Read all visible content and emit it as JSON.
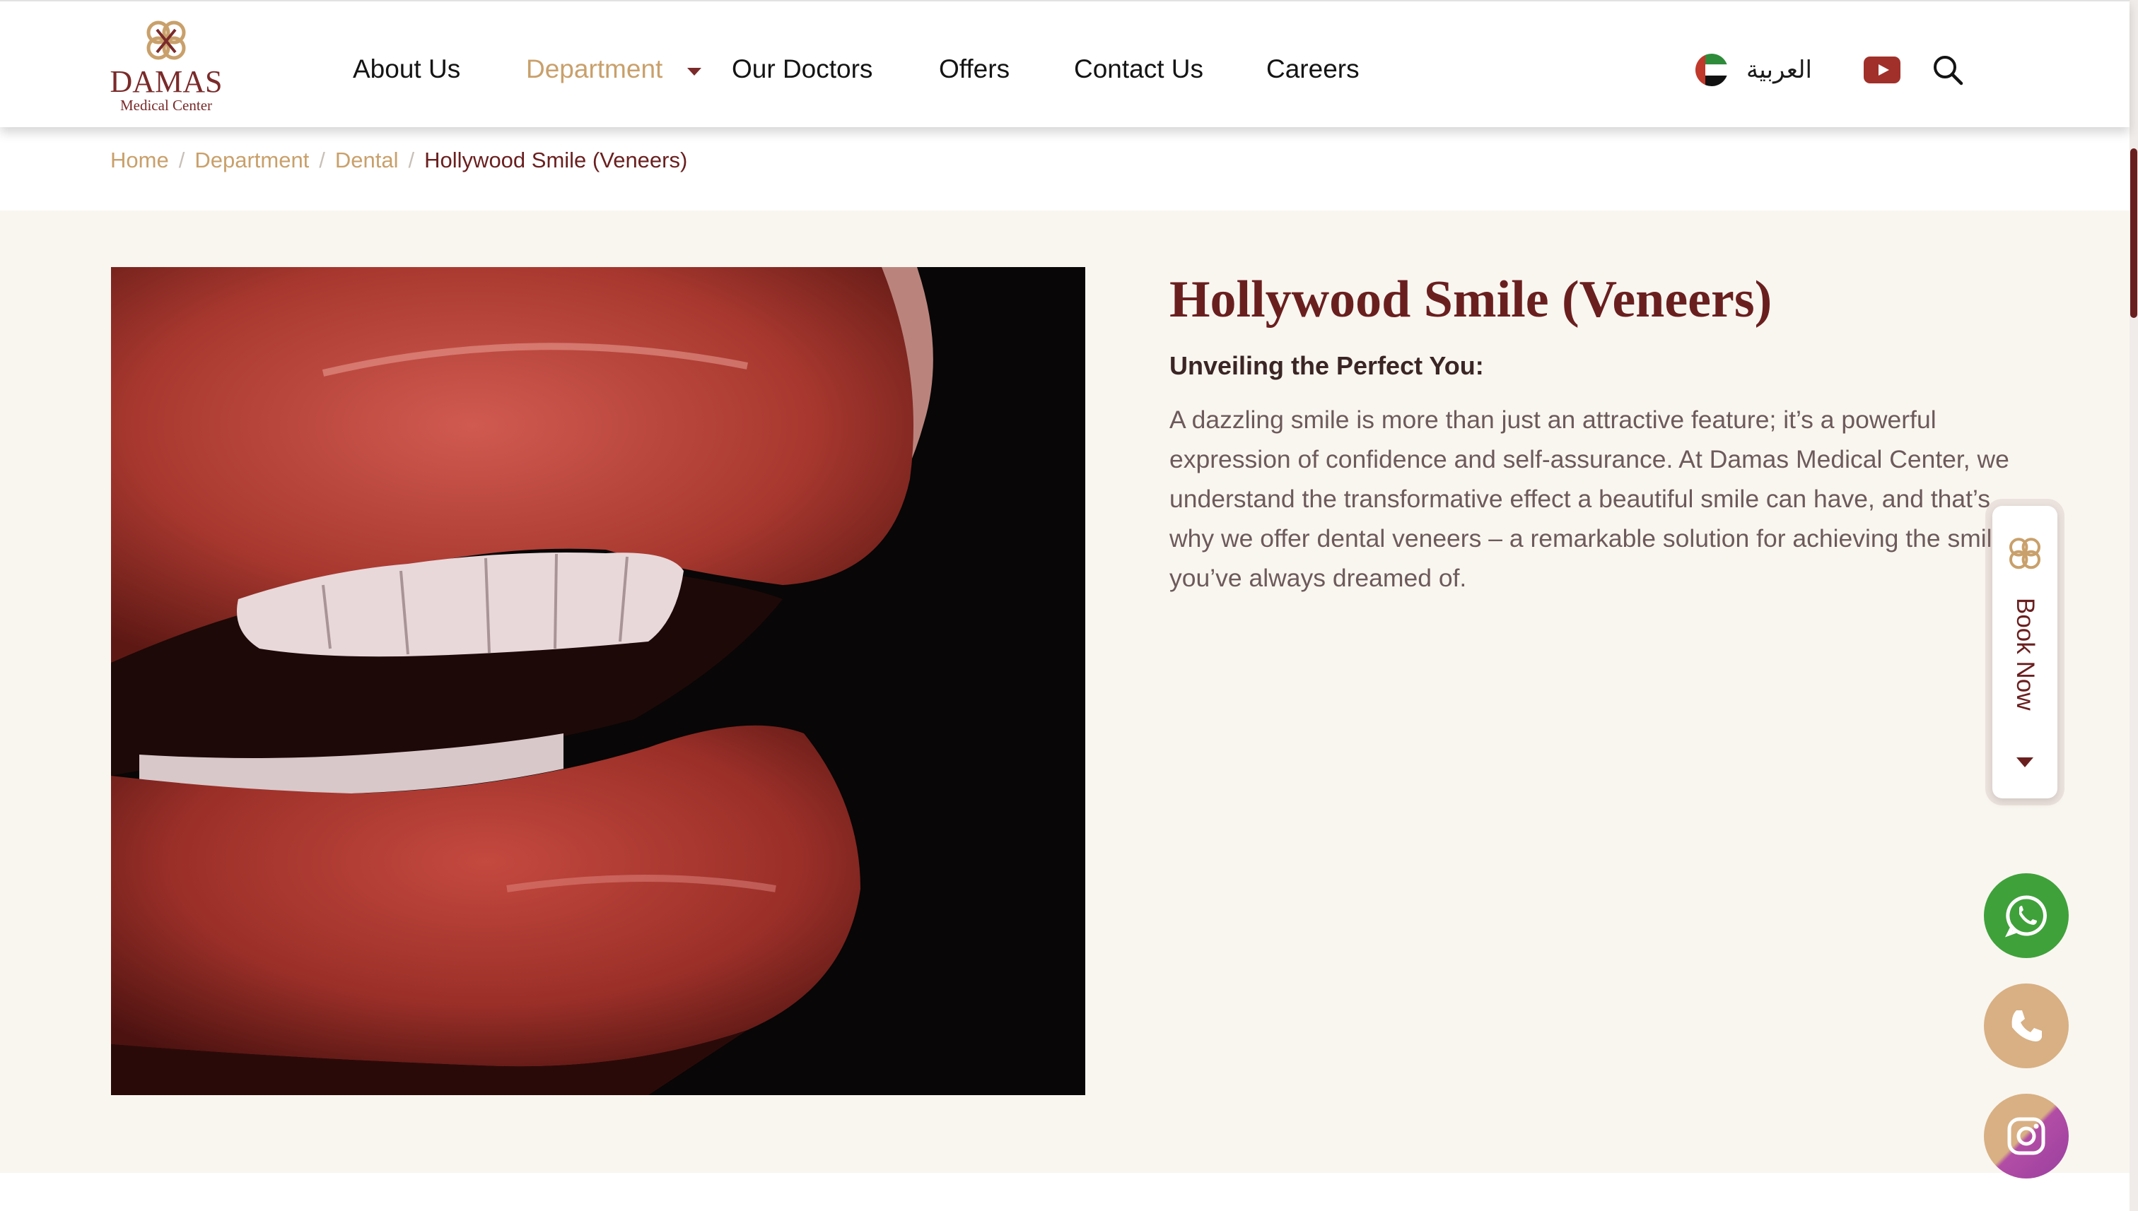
{
  "header": {
    "logo": {
      "title": "DAMAS",
      "subtitle": "Medical Center",
      "icon": "damas-knot-logo-icon",
      "color": "#7a2a2a",
      "accent": "#c9a06b"
    },
    "nav": [
      {
        "label": "About Us"
      },
      {
        "label": "Department",
        "active": true,
        "icon": "chevron-down-icon"
      },
      {
        "label": "Our Doctors"
      },
      {
        "label": "Offers"
      },
      {
        "label": "Contact Us"
      },
      {
        "label": "Careers"
      }
    ],
    "language": {
      "label": "العربية",
      "icon": "uae-flag-icon"
    },
    "youtube_icon": "youtube-icon",
    "search_icon": "search-icon"
  },
  "breadcrumb": [
    {
      "label": "Home"
    },
    {
      "label": "Department"
    },
    {
      "label": "Dental"
    },
    {
      "label": "Hollywood Smile (Veneers)",
      "current": true
    }
  ],
  "content": {
    "title": "Hollywood Smile (Veneers)",
    "subtitle": "Unveiling the Perfect You:",
    "body": "A dazzling smile is more than just an attractive feature; it’s a powerful expression of confidence and self-assurance. At Damas Medical Center, we understand the transformative effect a beautiful smile can have, and that’s why we offer dental veneers – a remarkable solution for achieving the smile you’ve always dreamed of.",
    "image": "smiling-lips-photo"
  },
  "floating": {
    "book_now": {
      "label": "Book Now",
      "icon": "chevron-down-icon"
    },
    "whatsapp": {
      "icon": "whatsapp-icon",
      "color": "#3fa13a"
    },
    "phone": {
      "icon": "phone-icon",
      "color": "#d8b083"
    },
    "instagram": {
      "icon": "instagram-icon",
      "color": "#b24da5"
    }
  },
  "colors": {
    "brand": "#6a1f1f",
    "gold": "#c9a06b",
    "page_bg": "#f9f6f0"
  }
}
